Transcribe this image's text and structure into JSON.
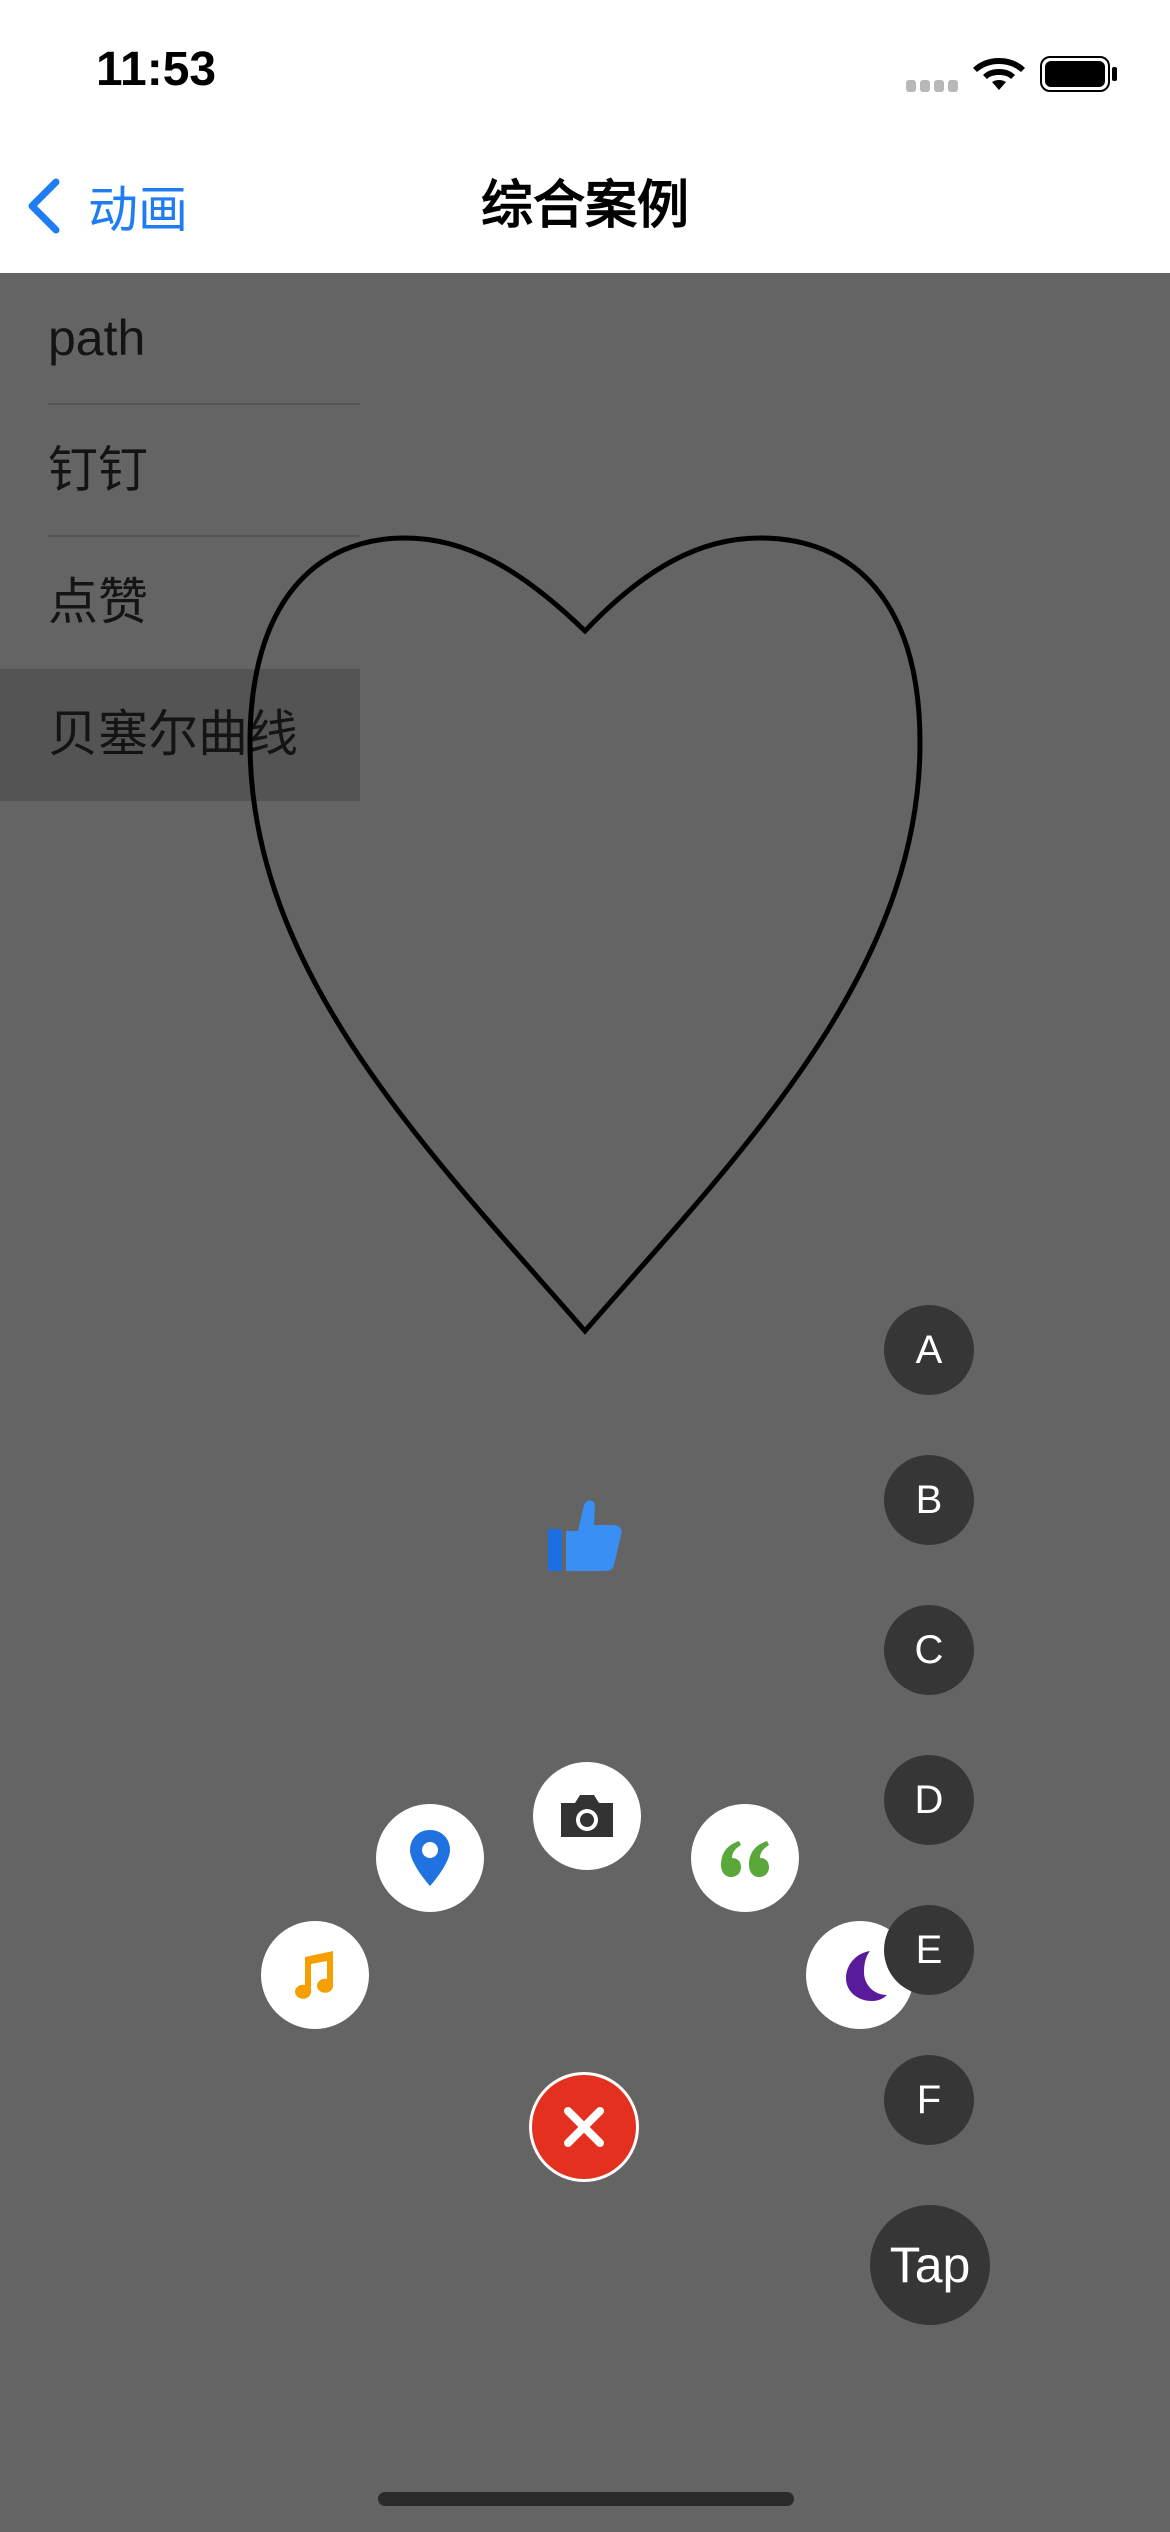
{
  "status_bar": {
    "time": "11:53"
  },
  "nav": {
    "back_label": "动画",
    "title": "综合案例"
  },
  "list": {
    "items": [
      {
        "label": "path",
        "selected": false
      },
      {
        "label": "钉钉",
        "selected": false
      },
      {
        "label": "点赞",
        "selected": false
      },
      {
        "label": "贝塞尔曲线",
        "selected": true
      }
    ]
  },
  "menu": {
    "items": [
      "music-note-icon",
      "location-pin-icon",
      "camera-icon",
      "quote-icon",
      "moon-icon"
    ],
    "colors": {
      "music": "#f5a000",
      "location": "#1f72e0",
      "camera": "#333333",
      "quote": "#5aa83a",
      "moon": "#5a1b9a",
      "close": "#e3301f"
    }
  },
  "letters": {
    "a": "A",
    "b": "B",
    "c": "C",
    "d": "D",
    "e": "E",
    "f": "F"
  },
  "tap_label": "Tap",
  "colors": {
    "accent": "#1f7cf3",
    "background": "#646464",
    "button_dark": "#363636"
  }
}
